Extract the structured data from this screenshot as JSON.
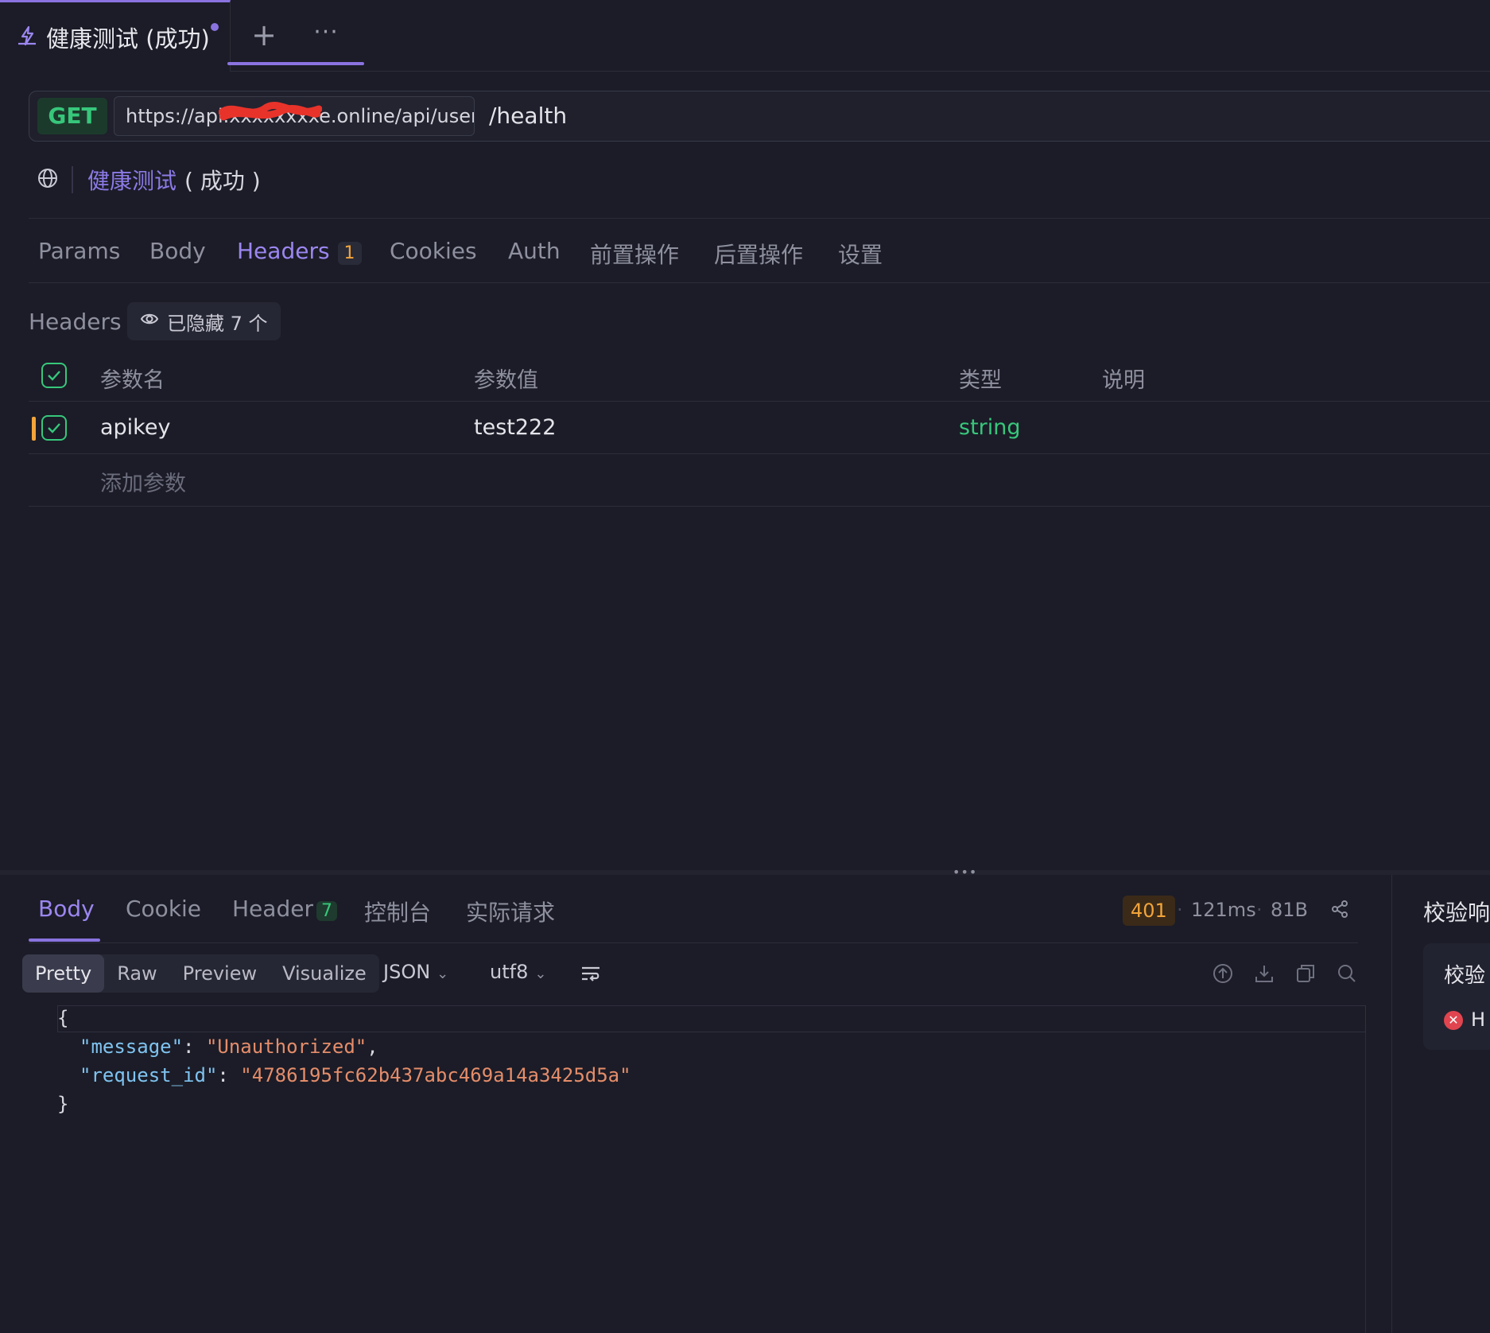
{
  "tab": {
    "title": "健康测试 (成功)",
    "add_label": "+",
    "more_label": "···"
  },
  "url": {
    "method": "GET",
    "base": "https://api.xxxxxxxxe.online/api/user",
    "path": "/health"
  },
  "name": {
    "link": "健康测试",
    "status": "( 成功 )"
  },
  "request_tabs": [
    "Params",
    "Body",
    "Headers",
    "Cookies",
    "Auth",
    "前置操作",
    "后置操作",
    "设置"
  ],
  "request_tab_badge": "1",
  "headers": {
    "label": "Headers",
    "hidden": "已隐藏 7 个",
    "columns": [
      "参数名",
      "参数值",
      "类型",
      "说明"
    ],
    "rows": [
      {
        "name": "apikey",
        "value": "test222",
        "type": "string",
        "desc": ""
      }
    ],
    "add_placeholder": "添加参数"
  },
  "response": {
    "tabs": [
      "Body",
      "Cookie",
      "Header",
      "控制台",
      "实际请求"
    ],
    "header_count": "7",
    "status": "401",
    "time": "121ms",
    "size": "81B",
    "formats": [
      "Pretty",
      "Raw",
      "Preview",
      "Visualize"
    ],
    "lang": "JSON",
    "encoding": "utf8",
    "code": {
      "open": "{",
      "k1": "\"message\"",
      "v1": "\"Unauthorized\"",
      "k2": "\"request_id\"",
      "v2": "\"4786195fc62b437abc469a14a3425d5a\"",
      "close": "}"
    }
  },
  "right_panel": {
    "title": "校验响",
    "card_title": "校验",
    "error": "H"
  },
  "colors": {
    "accent": "#8a73e0",
    "success": "#37c77b",
    "warning": "#f3a43a",
    "error": "#e0454f"
  }
}
